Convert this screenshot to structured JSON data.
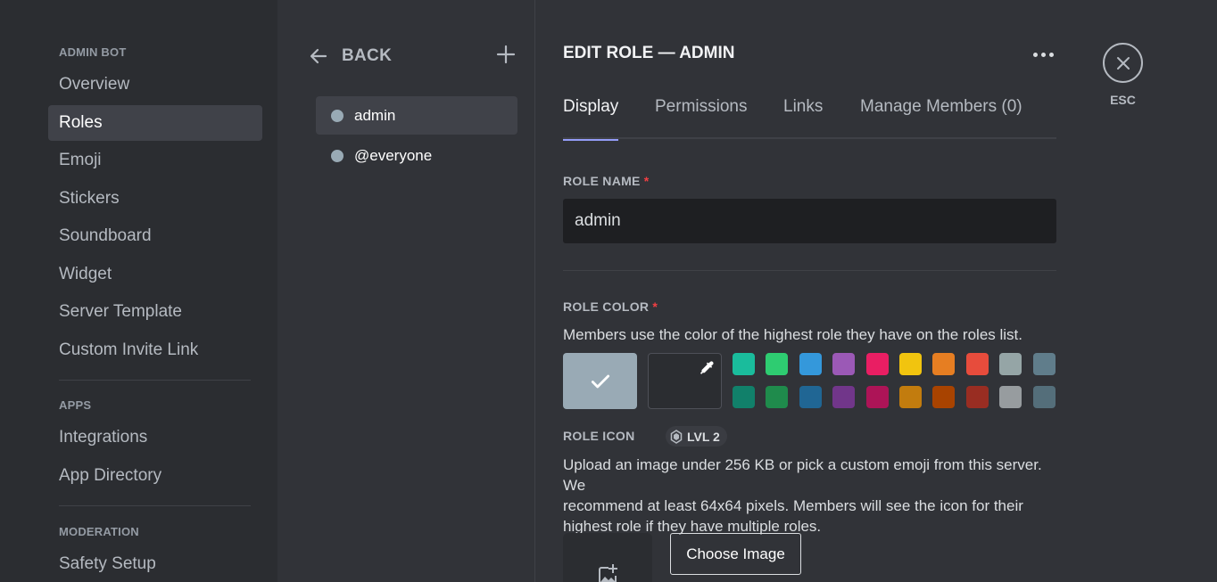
{
  "sidebar": {
    "sections": [
      {
        "header": "ADMIN BOT",
        "items": [
          "Overview",
          "Roles",
          "Emoji",
          "Stickers",
          "Soundboard",
          "Widget",
          "Server Template",
          "Custom Invite Link"
        ]
      },
      {
        "header": "APPS",
        "items": [
          "Integrations",
          "App Directory"
        ]
      },
      {
        "header": "MODERATION",
        "items": [
          "Safety Setup"
        ]
      }
    ],
    "active_item": "Roles"
  },
  "roles_panel": {
    "back_label": "BACK",
    "roles": [
      {
        "name": "admin",
        "color": "#99aab5",
        "selected": true
      },
      {
        "name": "@everyone",
        "color": "#99aab5",
        "selected": false
      }
    ]
  },
  "edit": {
    "title": "EDIT ROLE — ADMIN",
    "tabs": [
      "Display",
      "Permissions",
      "Links",
      "Manage Members (0)"
    ],
    "active_tab": "Display",
    "role_name_label": "ROLE NAME",
    "role_name_value": "admin",
    "required_marker": "*",
    "role_color_label": "ROLE COLOR",
    "role_color_desc": "Members use the color of the highest role they have on the roles list.",
    "default_color": "#99aab5",
    "swatches": [
      "#1abc9c",
      "#2ecc71",
      "#3498db",
      "#9b59b6",
      "#e91e63",
      "#f1c40f",
      "#e67e22",
      "#e74c3c",
      "#95a5a6",
      "#607d8b",
      "#11806a",
      "#1f8b4c",
      "#206694",
      "#71368a",
      "#ad1457",
      "#c27c0e",
      "#a84300",
      "#992d22",
      "#979c9f",
      "#546e7a"
    ],
    "role_icon_label": "ROLE ICON",
    "level_badge": "LVL 2",
    "role_icon_desc": [
      "Upload an image under 256 KB or pick a custom emoji from this server. We",
      "recommend at least 64x64 pixels. Members will see the icon for their",
      "highest role if they have multiple roles."
    ],
    "choose_image_label": "Choose Image"
  },
  "close": {
    "esc_label": "ESC"
  },
  "colors": {
    "accent_underline": "#949cf7",
    "required": "#f23f43"
  }
}
